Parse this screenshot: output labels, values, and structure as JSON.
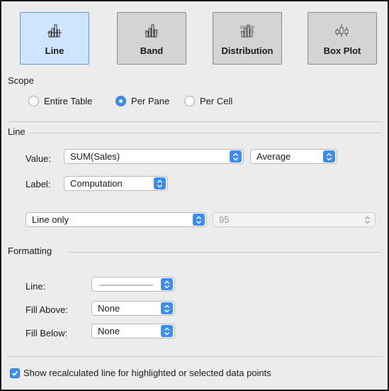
{
  "types": [
    {
      "label": "Line",
      "icon": "line-reference-icon",
      "selected": true
    },
    {
      "label": "Band",
      "icon": "band-reference-icon",
      "selected": false
    },
    {
      "label": "Distribution",
      "icon": "distribution-reference-icon",
      "selected": false
    },
    {
      "label": "Box Plot",
      "icon": "box-plot-icon",
      "selected": false
    }
  ],
  "scope": {
    "title": "Scope",
    "options": [
      {
        "label": "Entire Table",
        "selected": false
      },
      {
        "label": "Per Pane",
        "selected": true
      },
      {
        "label": "Per Cell",
        "selected": false
      }
    ]
  },
  "line": {
    "title": "Line",
    "value_label": "Value:",
    "value_field": "SUM(Sales)",
    "aggregation": "Average",
    "label_label": "Label:",
    "label_value": "Computation",
    "tooltip_mode": "Line only",
    "confidence_value": "95"
  },
  "formatting": {
    "title": "Formatting",
    "line_label": "Line:",
    "fill_above_label": "Fill Above:",
    "fill_above_value": "None",
    "fill_below_label": "Fill Below:",
    "fill_below_value": "None"
  },
  "footer": {
    "checkbox_label": "Show recalculated line for highlighted or selected data points",
    "checked": true
  },
  "colors": {
    "accent": "#3b8cf3",
    "selected_bg": "#cfe4ff",
    "panel_bg": "#ececec"
  }
}
